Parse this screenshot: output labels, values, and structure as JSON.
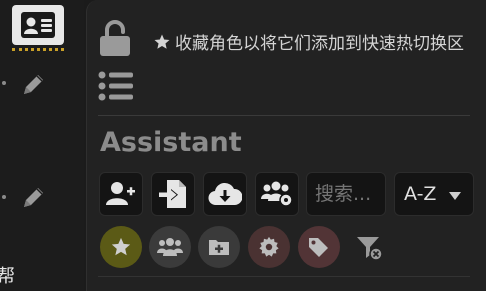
{
  "sidebar": {
    "truncated_text": "帮"
  },
  "panel": {
    "hint_text": "收藏角色以将它们添加到快速热切换区",
    "title": "Assistant",
    "toolbar": {
      "icons": [
        "add-user-icon",
        "import-file-icon",
        "cloud-download-icon",
        "group-settings-icon"
      ]
    },
    "search": {
      "placeholder": "搜索..."
    },
    "sort": {
      "selected": "A-Z"
    },
    "filters": {
      "icons": [
        "star-icon",
        "group-icon",
        "add-folder-icon",
        "gear-icon",
        "tags-icon",
        "clear-filter-icon"
      ]
    }
  },
  "colors": {
    "favorite_active": "#5b5a16",
    "groups_active": "#3b3b3b",
    "folder_active": "#3a3a3a",
    "settings_active": "#4a3232",
    "tags_active": "#523436"
  }
}
